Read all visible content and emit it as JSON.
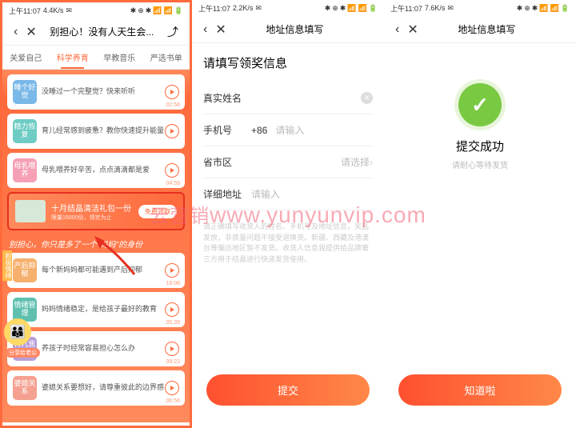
{
  "status": {
    "time": "上午11:07",
    "speed1": "4.4K/s",
    "speed2": "2.2K/s",
    "speed3": "7.6K/s"
  },
  "p1": {
    "title": "别担心！没有人天生会...",
    "tabs": [
      "关爱自己",
      "科学养育",
      "早教音乐",
      "严选书单"
    ],
    "cards": [
      {
        "tag": "睡个好觉",
        "text": "没睡过一个完整觉？快来听听",
        "dur": "02:56"
      },
      {
        "tag": "精力恢复",
        "text": "育儿经常感到疲惫？教你快速提升能量",
        "dur": ""
      },
      {
        "tag": "母乳喂养",
        "text": "母乳喂养好辛苦，点点滴滴都是爱",
        "dur": "04:59"
      }
    ],
    "promo": {
      "title": "十月结晶清洁礼包一份",
      "sub": "限量15000份，领完为止",
      "btn": "免费领取"
    },
    "section": "别担心，你只是多了一个\"妈妈\"的身份",
    "cards2": [
      {
        "tag": "产后抑郁",
        "text": "每个新妈妈都可能遇到产后抑郁",
        "dur": "18:08"
      },
      {
        "tag": "情绪管理",
        "text": "妈妈情绪稳定，是给孩子最好的教育",
        "dur": "05:39"
      },
      {
        "tag": "育儿焦虑",
        "text": "养孩子时经常容易担心怎么办",
        "dur": "09:23"
      },
      {
        "tag": "婆媳关系",
        "text": "婆媳关系要想好，请尊重彼此的边界感",
        "dur": "06:56"
      }
    ],
    "sideTag": "积极情绪",
    "shareLabel": "分享给老公"
  },
  "p2": {
    "title": "地址信息填写",
    "formTitle": "请填写领奖信息",
    "rows": {
      "name": "真实姓名",
      "phone": "手机号",
      "phonePrefix": "+86",
      "phonePlaceholder": "请输入",
      "region": "省市区",
      "regionPlaceholder": "请选择",
      "address": "详细地址",
      "addressPlaceholder": "请输入"
    },
    "note": "请正确填写收货人的姓名、手机号及地址信息，奖品发放，非质量问题不接受退换货。新疆、西藏及港澳台等偏远地区暂不发货。收货人信息我提供给品牌第三方用于结晶进行快递发货使用。",
    "submit": "提交"
  },
  "p3": {
    "title": "地址信息填写",
    "successTitle": "提交成功",
    "successSub": "请耐心等待发货",
    "btn": "知道啦"
  },
  "watermark": {
    "cn": "云营销",
    "en": "www.yunyunvip.com"
  }
}
